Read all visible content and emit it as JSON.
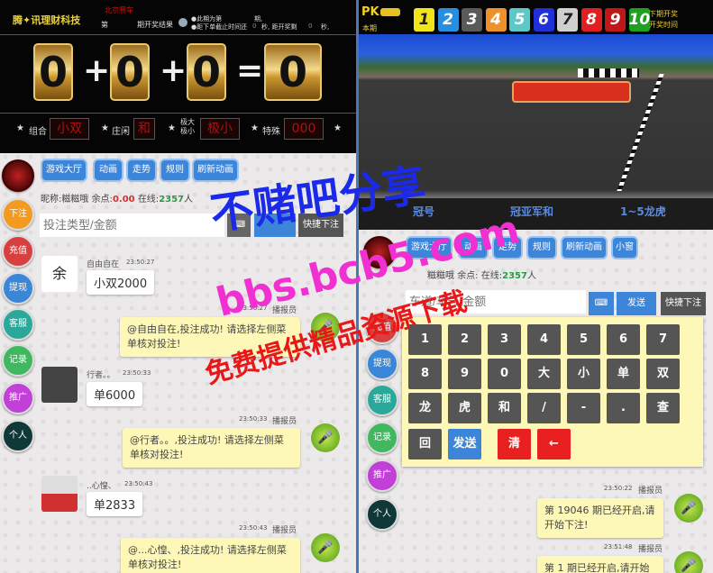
{
  "left": {
    "header": {
      "brand": "腾✦讯理财科技",
      "live_label": "北京赛车",
      "period_prefix": "第",
      "period_suffix": "期开奖结果",
      "notice1": "●此期为第",
      "notice2": "●距下单截止时间还",
      "notice3": "期,",
      "notice4": "秒, 距开奖剩",
      "notice5": "秒,",
      "timer1": "0",
      "timer2": "0"
    },
    "digits": [
      "0",
      "0",
      "0",
      "0"
    ],
    "ops": [
      "+",
      "+",
      "="
    ],
    "stats": [
      {
        "label": "组合",
        "value": "小双"
      },
      {
        "label": "庄闲",
        "value": "和"
      },
      {
        "label": "极大极小",
        "value": "极小"
      },
      {
        "label": "特殊",
        "value": "000"
      }
    ],
    "side": [
      "下注",
      "充值",
      "提现",
      "客服",
      "记录",
      "推广",
      "个人"
    ],
    "tabs": [
      "游戏大厅",
      "动画",
      "走势",
      "规则",
      "刷新动画"
    ],
    "info": {
      "nick_label": "昵称:",
      "nick": "糍糍哦",
      "balance_label": "余点:",
      "balance": "0.00",
      "online_label": "在线:",
      "online": "2357",
      "online_unit": "人"
    },
    "input": {
      "placeholder": "投注类型/金额"
    },
    "quick_bet": "快捷下注",
    "messages": [
      {
        "type": "user",
        "name": "自由自在",
        "time": "23:50:27",
        "text": "小双2000"
      },
      {
        "type": "bot",
        "name": "播报员",
        "time": "23:50:27",
        "text": "@自由自在,投注成功! 请选择左侧菜单核对投注!"
      },
      {
        "type": "user",
        "name": "行者。。",
        "time": "23:50:33",
        "text": "单6000"
      },
      {
        "type": "bot",
        "name": "播报员",
        "time": "23:50:33",
        "text": "@行者。。,投注成功! 请选择左侧菜单核对投注!"
      },
      {
        "type": "user",
        "name": "..心惶、",
        "time": "23:50:43",
        "text": "单2833"
      },
      {
        "type": "bot",
        "name": "播报员",
        "time": "23:50:43",
        "text": "@...心惶、,投注成功! 请选择左侧菜单核对投注!"
      }
    ]
  },
  "right": {
    "header": {
      "logo": "PK",
      "period_label": "本期",
      "numbers": [
        "1",
        "2",
        "3",
        "4",
        "5",
        "6",
        "7",
        "8",
        "9",
        "10"
      ],
      "next_draw1": "下期开奖",
      "next_draw2": "开奖时间"
    },
    "num_colors": [
      "#f2e41a",
      "#2a8ee0",
      "#5a5a5a",
      "#f0902a",
      "#5cc8c8",
      "#2030d8",
      "#d0d0d0",
      "#e02020",
      "#c01818",
      "#20a020"
    ],
    "track_labels": [
      "冠号",
      "冠亚军和",
      "1~5龙虎"
    ],
    "side": [
      "充值",
      "提现",
      "客服",
      "记录",
      "推广",
      "个人"
    ],
    "tabs": [
      "游戏大厅",
      "动画",
      "走势",
      "规则",
      "刷新动画",
      "小窗"
    ],
    "info": {
      "nick": "糍糍哦",
      "balance_label": "余点:",
      "online_label": "在线:",
      "online": "2357",
      "online_unit": "人"
    },
    "input": {
      "placeholder": "车道/车号/金额"
    },
    "send": "发送",
    "quick_bet": "快捷下注",
    "keypad": [
      [
        "1",
        "2",
        "3",
        "4",
        "5",
        "6",
        "7"
      ],
      [
        "8",
        "9",
        "0",
        "大",
        "小",
        "单",
        "双"
      ],
      [
        "龙",
        "虎",
        "和",
        "/",
        "-",
        ".",
        "查"
      ]
    ],
    "keypad_last": [
      "回",
      "发送",
      "清",
      "←"
    ],
    "messages": [
      {
        "name": "播报员",
        "time": "23:50:22",
        "text": "第 19046 期已经开启,请开始下注!"
      },
      {
        "name": "播报员",
        "time": "23:51:48",
        "text": "第 1 期已经开启,请开始下"
      }
    ]
  },
  "watermarks": [
    "不赌吧分享",
    "bbs.bcb5.com",
    "免费提供精品资源下载"
  ]
}
